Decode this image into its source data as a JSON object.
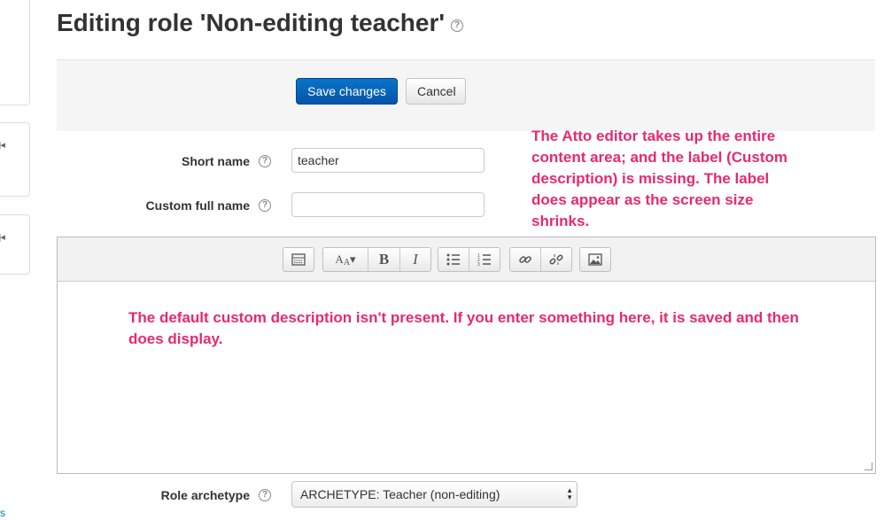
{
  "page": {
    "title": "Editing role 'Non-editing teacher'"
  },
  "buttons": {
    "save_label": "Save changes",
    "cancel_label": "Cancel"
  },
  "form": {
    "short_name_label": "Short name",
    "short_name_value": "teacher",
    "custom_full_name_label": "Custom full name",
    "custom_full_name_value": "",
    "role_archetype_label": "Role archetype",
    "role_archetype_value": "ARCHETYPE: Teacher (non-editing)"
  },
  "sidebar": {
    "link_fragment": "s"
  },
  "annotations": {
    "atto_note": [
      "The Atto editor takes up the entire",
      "content area; and the label (Custom",
      "description) is missing. The label",
      "does appear as the screen size",
      "shrinks."
    ],
    "description_note": [
      "The default custom description isn't present. If you enter something here, it is saved and then",
      "does display."
    ],
    "color": "#e8296e"
  },
  "editor_toolbar": {
    "icons": [
      "collapse-icon",
      "font-style-icon",
      "bold-icon",
      "italic-icon",
      "unordered-list-icon",
      "ordered-list-icon",
      "link-icon",
      "unlink-icon",
      "image-icon"
    ]
  },
  "colors": {
    "primary_button": "#0554a6",
    "button_bar_bg": "#f5f5f5"
  }
}
